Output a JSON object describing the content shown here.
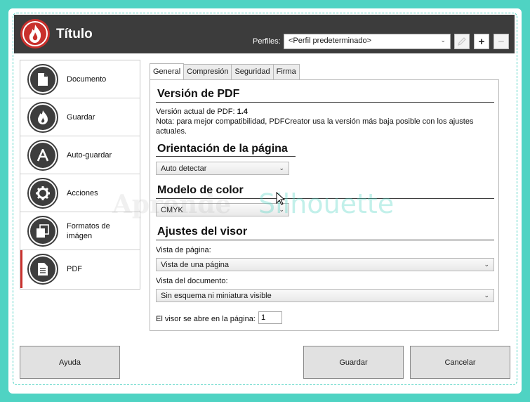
{
  "window": {
    "title": "Título"
  },
  "header": {
    "profiles_label": "Perfiles:",
    "profile_selected": "<Perfil predeterminado>"
  },
  "sidebar": {
    "items": [
      {
        "label": "Documento",
        "icon": "document-icon"
      },
      {
        "label": "Guardar",
        "icon": "flame-icon"
      },
      {
        "label": "Auto-guardar",
        "icon": "letter-a-icon"
      },
      {
        "label": "Acciones",
        "icon": "gear-icon"
      },
      {
        "label": "Formatos de imágen",
        "icon": "stacked-pages-icon"
      },
      {
        "label": "PDF",
        "icon": "pdf-document-icon",
        "active": true
      }
    ]
  },
  "tabs": [
    "General",
    "Compresión",
    "Seguridad",
    "Firma"
  ],
  "general": {
    "version": {
      "heading": "Versión de PDF",
      "current_label": "Versión actual de PDF:",
      "current_value": "1.4",
      "note": "Nota: para mejor compatibilidad, PDFCreator usa la versión más baja posible con los ajustes actuales."
    },
    "orientation": {
      "heading": "Orientación de la página",
      "value": "Auto detectar"
    },
    "color": {
      "heading": "Modelo de color",
      "value": "CMYK"
    },
    "viewer": {
      "heading": "Ajustes del visor",
      "page_view_label": "Vista de página:",
      "page_view_value": "Vista de una página",
      "doc_view_label": "Vista del documento:",
      "doc_view_value": "Sin esquema ni miniatura visible",
      "open_page_label": "El visor se abre en la página:",
      "open_page_value": "1"
    }
  },
  "footer": {
    "help": "Ayuda",
    "save": "Guardar",
    "cancel": "Cancelar"
  },
  "watermark": {
    "part1": "Aprende",
    "part2": "Silhouette"
  },
  "colors": {
    "accent": "#c9302c",
    "titlebar": "#3c3c3c",
    "frame": "#4fd3c3"
  }
}
